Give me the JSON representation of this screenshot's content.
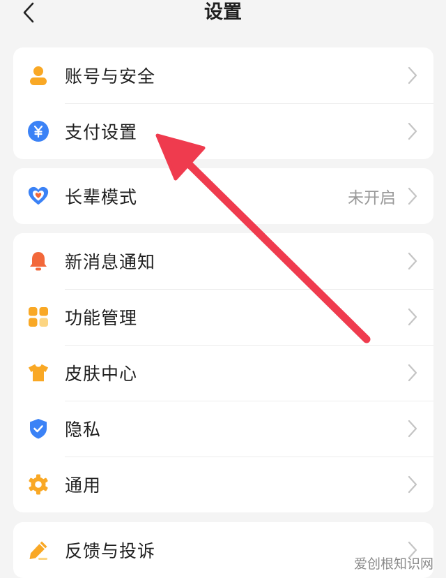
{
  "header": {
    "title": "设置"
  },
  "group1": [
    {
      "label": "账号与安全",
      "icon": "user-icon",
      "color": "#F9A825"
    },
    {
      "label": "支付设置",
      "icon": "yuan-icon",
      "color": "#3B82F6"
    }
  ],
  "group2": [
    {
      "label": "长辈模式",
      "value": "未开启",
      "icon": "heart-icon",
      "color": "#3B82F6"
    }
  ],
  "group3": [
    {
      "label": "新消息通知",
      "icon": "bell-icon",
      "color": "#F2683A"
    },
    {
      "label": "功能管理",
      "icon": "grid-icon",
      "color": "#F9A825"
    },
    {
      "label": "皮肤中心",
      "icon": "tshirt-icon",
      "color": "#F9A825"
    },
    {
      "label": "隐私",
      "icon": "shield-icon",
      "color": "#3B82F6"
    },
    {
      "label": "通用",
      "icon": "gear-icon",
      "color": "#F9A825"
    }
  ],
  "group4": [
    {
      "label": "反馈与投诉",
      "icon": "pencil-icon",
      "color": "#F9A825"
    }
  ],
  "watermark": "爱创根知识网",
  "colors": {
    "background": "#f4f4f4",
    "card": "#ffffff",
    "annotation_arrow": "#EF3B4E",
    "secondary_text": "#999999"
  }
}
